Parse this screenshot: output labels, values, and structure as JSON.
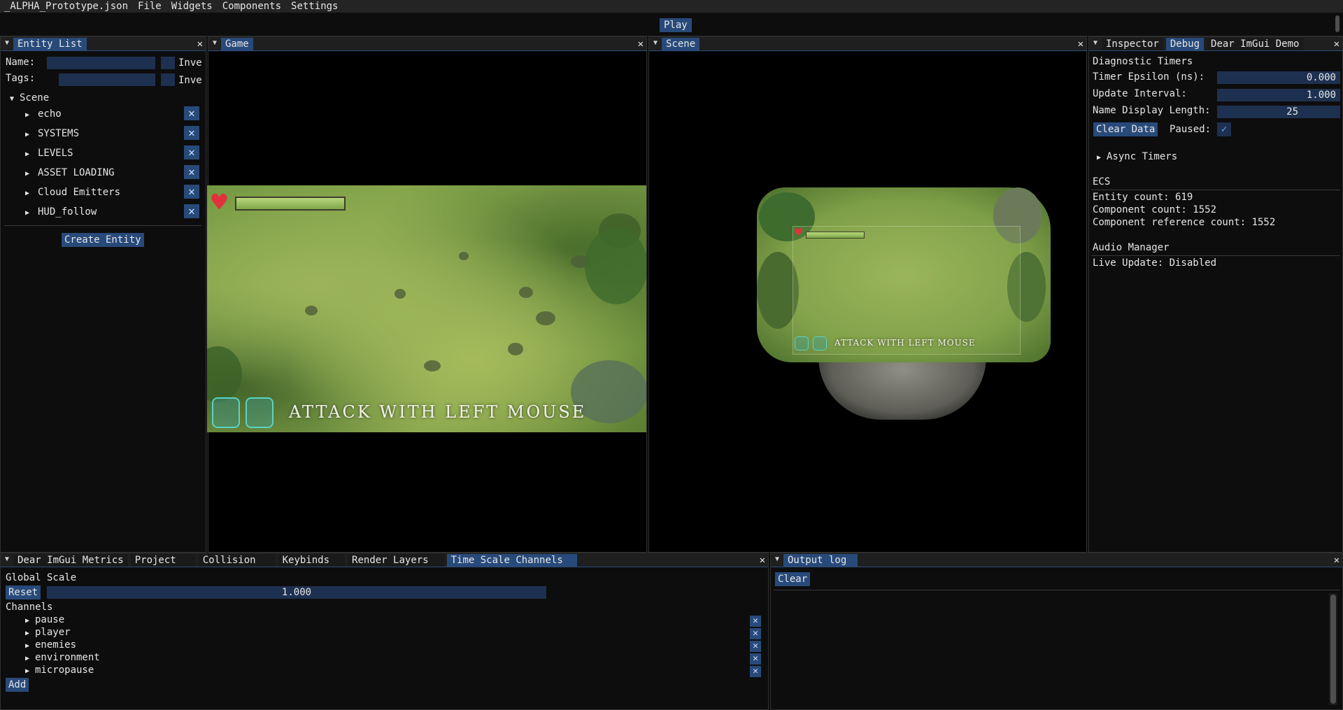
{
  "menubar": {
    "file_name": "_ALPHA_Prototype.json",
    "items": [
      "File",
      "Widgets",
      "Components",
      "Settings"
    ]
  },
  "toolbar": {
    "play_label": "Play"
  },
  "entity_list": {
    "tab": "Entity List",
    "name_label": "Name:",
    "tags_label": "Tags:",
    "invert_label": "Inve",
    "tree_root": "Scene",
    "items": [
      "echo",
      "SYSTEMS",
      "LEVELS",
      "ASSET LOADING",
      "Cloud Emitters",
      "HUD_follow"
    ],
    "create_label": "Create Entity"
  },
  "game_panel": {
    "tab": "Game",
    "hud_text": "ATTACK WITH LEFT MOUSE"
  },
  "scene_panel": {
    "tab": "Scene",
    "hud_text": "ATTACK WITH LEFT MOUSE"
  },
  "inspector": {
    "tabs": [
      "Inspector",
      "Debug",
      "Dear ImGui Demo"
    ],
    "active_tab": "Debug",
    "diag_header": "Diagnostic Timers",
    "timer_epsilon_label": "Timer Epsilon (ns):",
    "timer_epsilon_value": "0.000",
    "update_interval_label": "Update Interval:",
    "update_interval_value": "1.000",
    "name_len_label": "Name Display Length:",
    "name_len_value": "25",
    "clear_data_label": "Clear Data",
    "paused_label": "Paused:",
    "paused_checked": true,
    "async_timers_label": "Async Timers",
    "ecs_header": "ECS",
    "entity_count": "Entity count: 619",
    "component_count": "Component count: 1552",
    "component_ref_count": "Component reference count: 1552",
    "audio_header": "Audio Manager",
    "live_update": "Live Update: Disabled"
  },
  "bottom_left": {
    "tabs": [
      "Dear ImGui Metrics",
      "Project",
      "Collision",
      "Keybinds",
      "Render Layers",
      "Time Scale Channels"
    ],
    "active_tab": "Time Scale Channels",
    "global_scale_label": "Global Scale",
    "reset_label": "Reset",
    "global_scale_value": "1.000",
    "channels_label": "Channels",
    "channels": [
      "pause",
      "player",
      "enemies",
      "environment",
      "micropause"
    ],
    "add_label": "Add"
  },
  "output_log": {
    "tab": "Output log",
    "clear_label": "Clear"
  },
  "colors": {
    "accent": "#284a7a",
    "field_bg": "#1e3050",
    "panel_bg": "#0d0d0d",
    "title_bg": "#1f1f1f"
  }
}
